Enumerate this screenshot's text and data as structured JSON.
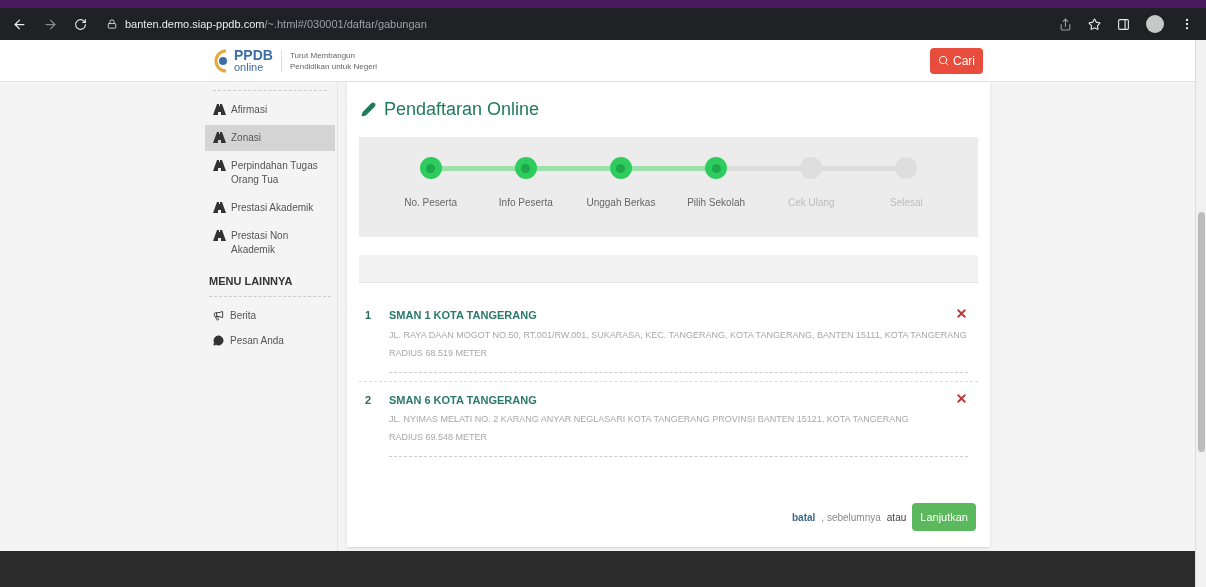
{
  "browser": {
    "url_host": "banten.demo.siap-ppdb.com",
    "url_path": "/~.html#/030001/daftar/gabungan"
  },
  "header": {
    "logo_top": "PPDB",
    "logo_bottom": "online",
    "tagline": [
      "Turut Membangun",
      "Pendidikan untuk Negeri"
    ],
    "search_button": "Cari"
  },
  "sidebar": {
    "items": [
      {
        "label": "Afirmasi",
        "selected": false
      },
      {
        "label": "Zonasi",
        "selected": true
      },
      {
        "label": "Perpindahan Tugas Orang Tua",
        "selected": false
      },
      {
        "label": "Prestasi Akademik",
        "selected": false
      },
      {
        "label": "Prestasi Non Akademik",
        "selected": false
      }
    ],
    "section_title": "MENU LAINNYA",
    "other_items": [
      {
        "kind": "news",
        "label": "Berita"
      },
      {
        "kind": "message",
        "label": "Pesan Anda"
      }
    ]
  },
  "main": {
    "title": "Pendaftaran Online",
    "steps": [
      {
        "label": "No. Peserta",
        "done": true
      },
      {
        "label": "Info Peserta",
        "done": true
      },
      {
        "label": "Unggah Berkas",
        "done": true
      },
      {
        "label": "Pilih Sekolah",
        "done": true
      },
      {
        "label": "Cek Ulang",
        "done": false
      },
      {
        "label": "Selesai",
        "done": false
      }
    ],
    "schools": [
      {
        "number": "1",
        "name": "SMAN 1 KOTA TANGERANG",
        "address": "JL. RAYA DAAN MOGOT NO.50, RT.001/RW.001, SUKARASA, KEC. TANGERANG, KOTA TANGERANG, BANTEN 15111, KOTA TANGERANG",
        "radius": "RADIUS 68.519 METER"
      },
      {
        "number": "2",
        "name": "SMAN 6 KOTA TANGERANG",
        "address": "JL. NYIMAS MELATI NO. 2 KARANG ANYAR NEGLASARI KOTA TANGERANG PROVINSI BANTEN 15121, KOTA TANGERANG",
        "radius": "RADIUS 69.548 METER"
      }
    ],
    "actions": {
      "cancel": "batal",
      "back": ", sebelumnya",
      "or": "atau",
      "next": "Lanjutkan"
    }
  }
}
